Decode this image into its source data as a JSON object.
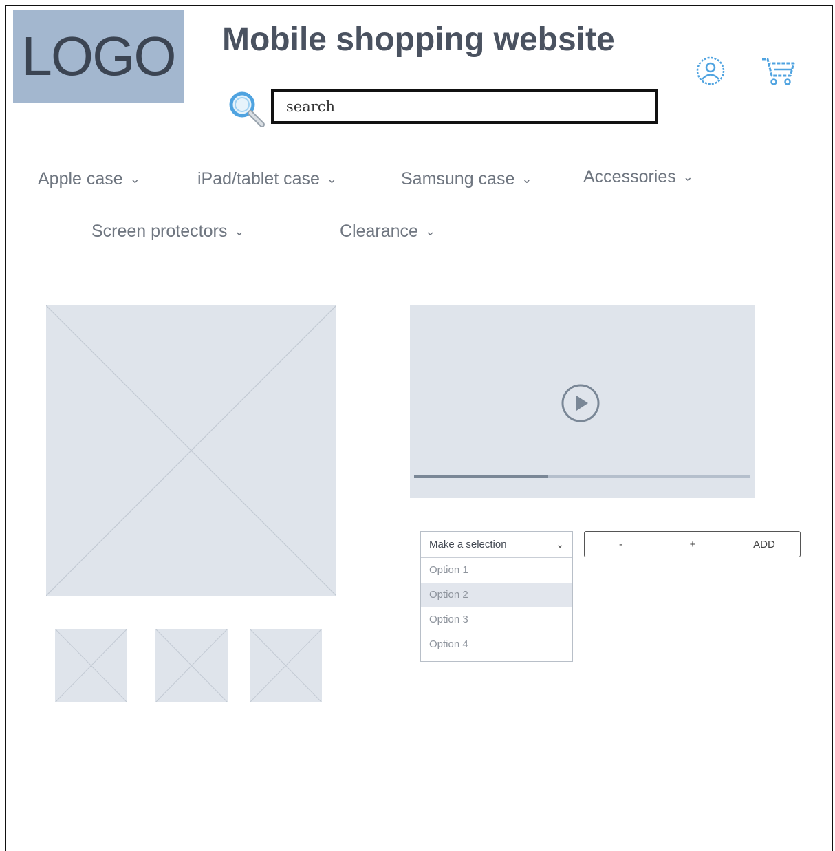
{
  "header": {
    "logo_text": "LOGO",
    "title": "Mobile shopping website",
    "search_placeholder": "search"
  },
  "nav": {
    "row1": [
      "Apple case",
      "iPad/tablet case",
      "Samsung case",
      "Accessories"
    ],
    "row2": [
      "Screen protectors",
      "Clearance"
    ],
    "chevron": "⌄"
  },
  "video": {
    "progress": 0.4
  },
  "select": {
    "placeholder": "Make a selection",
    "options": [
      "Option 1",
      "Option 2",
      "Option 3",
      "Option 4"
    ],
    "highlighted_index": 1
  },
  "quantity": {
    "minus_label": "-",
    "plus_label": "+",
    "add_label": "ADD"
  },
  "icons": {
    "search": "search-icon",
    "user": "user-icon",
    "cart": "cart-icon",
    "play": "play-icon"
  },
  "colors": {
    "logo_bg": "#a3b7cf",
    "placeholder_bg": "#dfe4eb",
    "icon_blue": "#4fa3e0",
    "title": "#4a5260"
  }
}
